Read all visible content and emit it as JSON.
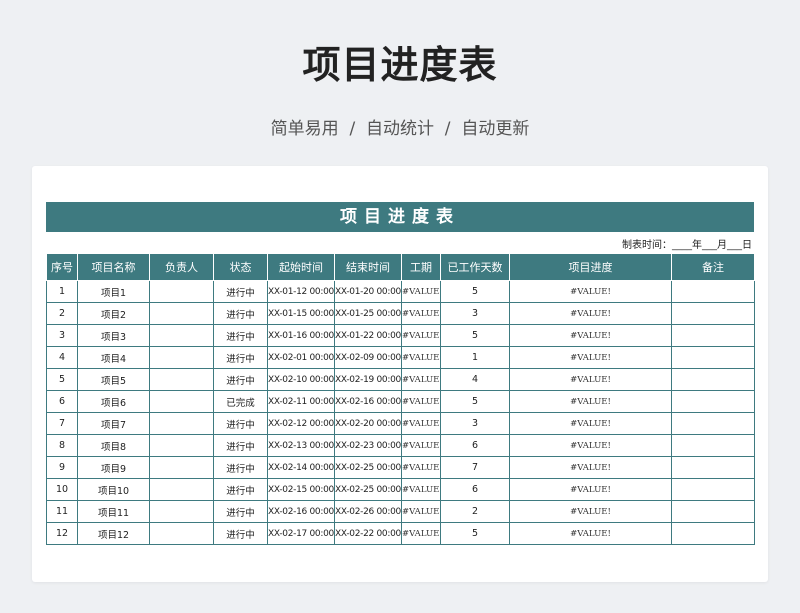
{
  "header": {
    "title": "项目进度表",
    "subtitle": "简单易用  /  自动统计  /  自动更新"
  },
  "sheet": {
    "banner_title": "项目进度表",
    "date_line": "制表时间：____年___月___日",
    "columns": [
      "序号",
      "项目名称",
      "负责人",
      "状态",
      "起始时间",
      "结束时间",
      "工期",
      "已工作天数",
      "项目进度",
      "备注"
    ],
    "rows": [
      {
        "no": "1",
        "name": "项目1",
        "owner": "",
        "status": "进行中",
        "start": "XX-01-12 00:00",
        "end": "XX-01-20 00:00",
        "duration": "#VALUE!",
        "worked": "5",
        "progress": "#VALUE!",
        "note": ""
      },
      {
        "no": "2",
        "name": "项目2",
        "owner": "",
        "status": "进行中",
        "start": "XX-01-15 00:00",
        "end": "XX-01-25 00:00",
        "duration": "#VALUE!",
        "worked": "3",
        "progress": "#VALUE!",
        "note": ""
      },
      {
        "no": "3",
        "name": "项目3",
        "owner": "",
        "status": "进行中",
        "start": "XX-01-16 00:00",
        "end": "XX-01-22 00:00",
        "duration": "#VALUE!",
        "worked": "5",
        "progress": "#VALUE!",
        "note": ""
      },
      {
        "no": "4",
        "name": "项目4",
        "owner": "",
        "status": "进行中",
        "start": "XX-02-01 00:00",
        "end": "XX-02-09 00:00",
        "duration": "#VALUE!",
        "worked": "1",
        "progress": "#VALUE!",
        "note": ""
      },
      {
        "no": "5",
        "name": "项目5",
        "owner": "",
        "status": "进行中",
        "start": "XX-02-10 00:00",
        "end": "XX-02-19 00:00",
        "duration": "#VALUE!",
        "worked": "4",
        "progress": "#VALUE!",
        "note": ""
      },
      {
        "no": "6",
        "name": "项目6",
        "owner": "",
        "status": "已完成",
        "start": "XX-02-11 00:00",
        "end": "XX-02-16 00:00",
        "duration": "#VALUE!",
        "worked": "5",
        "progress": "#VALUE!",
        "note": ""
      },
      {
        "no": "7",
        "name": "项目7",
        "owner": "",
        "status": "进行中",
        "start": "XX-02-12 00:00",
        "end": "XX-02-20 00:00",
        "duration": "#VALUE!",
        "worked": "3",
        "progress": "#VALUE!",
        "note": ""
      },
      {
        "no": "8",
        "name": "项目8",
        "owner": "",
        "status": "进行中",
        "start": "XX-02-13 00:00",
        "end": "XX-02-23 00:00",
        "duration": "#VALUE!",
        "worked": "6",
        "progress": "#VALUE!",
        "note": ""
      },
      {
        "no": "9",
        "name": "项目9",
        "owner": "",
        "status": "进行中",
        "start": "XX-02-14 00:00",
        "end": "XX-02-25 00:00",
        "duration": "#VALUE!",
        "worked": "7",
        "progress": "#VALUE!",
        "note": ""
      },
      {
        "no": "10",
        "name": "项目10",
        "owner": "",
        "status": "进行中",
        "start": "XX-02-15 00:00",
        "end": "XX-02-25 00:00",
        "duration": "#VALUE!",
        "worked": "6",
        "progress": "#VALUE!",
        "note": ""
      },
      {
        "no": "11",
        "name": "项目11",
        "owner": "",
        "status": "进行中",
        "start": "XX-02-16 00:00",
        "end": "XX-02-26 00:00",
        "duration": "#VALUE!",
        "worked": "2",
        "progress": "#VALUE!",
        "note": ""
      },
      {
        "no": "12",
        "name": "项目12",
        "owner": "",
        "status": "进行中",
        "start": "XX-02-17 00:00",
        "end": "XX-02-22 00:00",
        "duration": "#VALUE!",
        "worked": "5",
        "progress": "#VALUE!",
        "note": ""
      }
    ]
  },
  "colors": {
    "accent": "#3e7a80",
    "background": "#eef0f3",
    "card": "#ffffff"
  }
}
